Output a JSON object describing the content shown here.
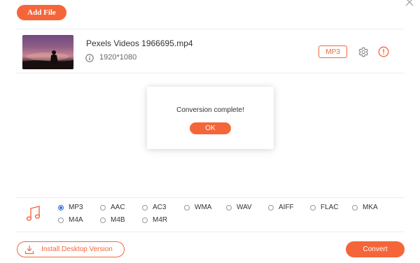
{
  "toolbar": {
    "add_file_label": "Add File"
  },
  "file": {
    "name": "Pexels Videos 1966695.mp4",
    "resolution": "1920*1080",
    "output_format": "MP3"
  },
  "dialog": {
    "message": "Conversion complete!",
    "ok_label": "OK"
  },
  "formats": {
    "selected": "MP3",
    "options": [
      "MP3",
      "AAC",
      "AC3",
      "WMA",
      "WAV",
      "AIFF",
      "FLAC",
      "MKA",
      "M4A",
      "M4B",
      "M4R"
    ]
  },
  "footer": {
    "install_label": "Install Desktop Version",
    "convert_label": "Convert"
  },
  "colors": {
    "accent": "#f4663a",
    "radio_selected": "#2a6fd6"
  },
  "icons": [
    "close-icon",
    "info-icon",
    "gear-icon",
    "alert-icon",
    "music-note-icon",
    "download-icon"
  ]
}
